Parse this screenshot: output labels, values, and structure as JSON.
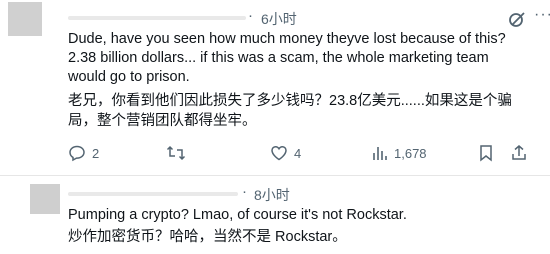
{
  "tweets": [
    {
      "time": "6小时",
      "separator": "·",
      "more_label": "···",
      "text_en": "Dude, have you seen how much money theyve lost because of this? 2.38 billion dollars... if this was a scam, the whole marketing team would go to prison.",
      "text_zh": "老兄，你看到他们因此损失了多少钱吗？23.8亿美元......如果这是个骗局，整个营销团队都得坐牢。",
      "replies": "2",
      "retweets": "",
      "likes": "4",
      "views": "1,678"
    },
    {
      "time": "8小时",
      "separator": "·",
      "text_en": "Pumping a crypto? Lmao, of course it's not Rockstar.",
      "text_zh": "炒作加密货币？哈哈，当然不是 Rockstar。"
    }
  ],
  "colors": {
    "text": "#0f1419",
    "muted": "#536471",
    "divider": "#e6e6e6"
  },
  "icons": [
    "grok-icon",
    "more-icon",
    "reply-icon",
    "retweet-icon",
    "like-icon",
    "views-icon",
    "bookmark-icon",
    "share-icon"
  ]
}
